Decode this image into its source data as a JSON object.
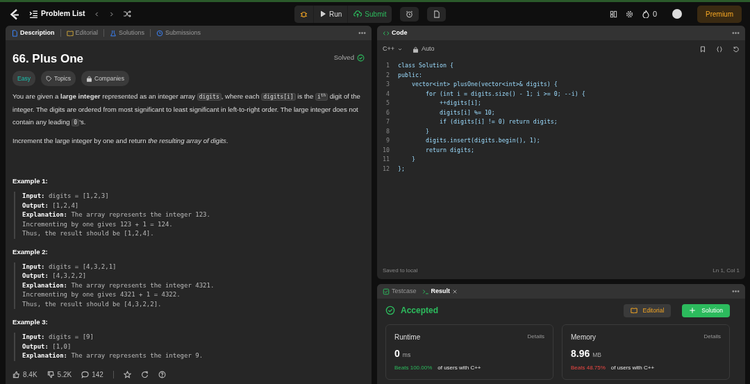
{
  "topbar": {
    "problem_list": "Problem List",
    "run": "Run",
    "submit": "Submit",
    "streak": "0",
    "premium": "Premium"
  },
  "description_panel": {
    "tabs": [
      {
        "label": "Description",
        "selected": true
      },
      {
        "label": "Editorial",
        "selected": false
      },
      {
        "label": "Solutions",
        "selected": false
      },
      {
        "label": "Submissions",
        "selected": false
      }
    ],
    "title": "66. Plus One",
    "status": "Solved",
    "difficulty": "Easy",
    "tags": [
      "Topics",
      "Companies"
    ],
    "paragraphs": [
      [
        {
          "kind": "text",
          "text": "You are given a **large integer** represented as an integer array "
        },
        {
          "kind": "code",
          "text": "digits"
        },
        {
          "kind": "text",
          "text": ", where each "
        },
        {
          "kind": "code",
          "text": "digits[i]"
        },
        {
          "kind": "text",
          "text": " is the "
        },
        {
          "kind": "code",
          "text": "i$^{th}$"
        },
        {
          "kind": "text",
          "text": " digit of the integer. The digits are ordered from most significant to least significant in left-to-right order. The large integer does not contain any leading "
        },
        {
          "kind": "code",
          "text": "0"
        },
        {
          "kind": "text",
          "text": "'s."
        }
      ],
      [
        {
          "kind": "text",
          "text": "Increment the large integer by one and return *the resulting array of digits*."
        }
      ]
    ],
    "examples": [
      {
        "title": "Example 1:",
        "lines": [
          {
            "label": "Input:",
            "text": "digits = [1,2,3]"
          },
          {
            "label": "Output:",
            "text": "[1,2,4]"
          },
          {
            "label": "Explanation:",
            "text": "The array represents the integer 123."
          },
          {
            "text": "Incrementing by one gives 123 + 1 = 124."
          },
          {
            "text": "Thus, the result should be [1,2,4]."
          }
        ]
      },
      {
        "title": "Example 2:",
        "lines": [
          {
            "label": "Input:",
            "text": "digits = [4,3,2,1]"
          },
          {
            "label": "Output:",
            "text": "[4,3,2,2]"
          },
          {
            "label": "Explanation:",
            "text": "The array represents the integer 4321."
          },
          {
            "text": "Incrementing by one gives 4321 + 1 = 4322."
          },
          {
            "text": "Thus, the result should be [4,3,2,2]."
          }
        ]
      },
      {
        "title": "Example 3:",
        "lines": [
          {
            "label": "Input:",
            "text": "digits = [9]"
          },
          {
            "label": "Output:",
            "text": "[1,0]"
          },
          {
            "label": "Explanation:",
            "text": "The array represents the integer 9."
          }
        ]
      }
    ],
    "likes": "8.4K",
    "dislikes": "5.2K",
    "comments": "142"
  },
  "code_panel": {
    "title": "Code",
    "language": "C++",
    "mode": "Auto",
    "lines": [
      {
        "number": "1",
        "text": "class Solution {"
      },
      {
        "number": "2",
        "text": "public:"
      },
      {
        "number": "3",
        "text": "    vector<int> plusOne(vector<int>& digits) {"
      },
      {
        "number": "4",
        "text": "        for (int i = digits.size() - 1; i >= 0; --i) {"
      },
      {
        "number": "5",
        "text": "            ++digits[i];"
      },
      {
        "number": "6",
        "text": "            digits[i] %= 10;"
      },
      {
        "number": "7",
        "text": "            if (digits[i] != 0) return digits;"
      },
      {
        "number": "8",
        "text": "        }"
      },
      {
        "number": "9",
        "text": "        digits.insert(digits.begin(), 1);"
      },
      {
        "number": "10",
        "text": "        return digits;"
      },
      {
        "number": "11",
        "text": "    }"
      },
      {
        "number": "12",
        "text": "};"
      }
    ],
    "saved": "Saved to local",
    "cursor": "Ln 1, Col 1"
  },
  "result_panel": {
    "tabs": [
      {
        "label": "Testcase",
        "selected": false
      },
      {
        "label": "Result",
        "selected": true
      }
    ],
    "verdict": "Accepted",
    "editorial": "Editorial",
    "solution": "Solution",
    "metrics": [
      {
        "name": "Runtime",
        "details": "Details",
        "value": "0",
        "unit": "ms",
        "beats": "Beats 100.00%",
        "suffix": "of users with C++",
        "kind": "good"
      },
      {
        "name": "Memory",
        "details": "Details",
        "value": "8.96",
        "unit": "MB",
        "beats": "Beats 48.75%",
        "suffix": "of users with C++",
        "kind": "bad"
      }
    ]
  }
}
